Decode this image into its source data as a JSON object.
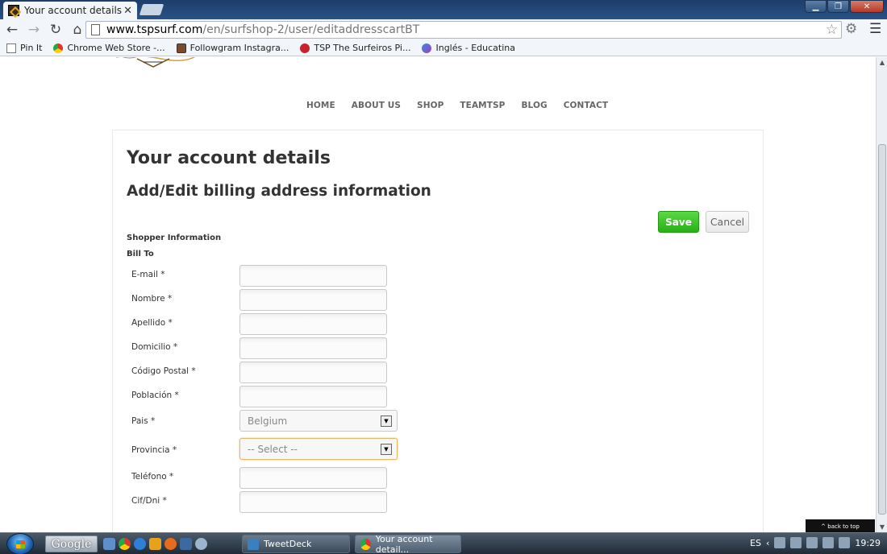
{
  "browser": {
    "tab_title": "Your account details",
    "tab_close": "✕",
    "url_host": "www.tspsurf.com",
    "url_path": "/en/surfshop-2/user/editaddresscartBT",
    "bookmarks": [
      "Pin It",
      "Chrome Web Store -...",
      "Followgram Instagra...",
      "TSP The Surfeiros Pi...",
      "Inglés - Educatina"
    ]
  },
  "nav": {
    "items": [
      "HOME",
      "ABOUT US",
      "SHOP",
      "TEAMTSP",
      "BLOG",
      "CONTACT"
    ]
  },
  "page": {
    "title": "Your account details",
    "subtitle": "Add/Edit billing address information",
    "save_label": "Save",
    "cancel_label": "Cancel",
    "section_shopper": "Shopper Information",
    "section_bill_to": "Bill To",
    "back_to_top": "^ back to top"
  },
  "form": {
    "email_label": "E-mail *",
    "nombre_label": "Nombre *",
    "apellido_label": "Apellido *",
    "domicilio_label": "Domicilio *",
    "codigo_label": "Código Postal *",
    "poblacion_label": "Población *",
    "pais_label": "Pais *",
    "pais_value": "Belgium",
    "provincia_label": "Provincia *",
    "provincia_value": "-- Select --",
    "telefono_label": "Teléfono *",
    "cif_label": "Cif/Dni *"
  },
  "taskbar": {
    "google": "Google",
    "tasks": [
      "TweetDeck",
      "Your account detail..."
    ],
    "lang": "ES",
    "clock": "19:29"
  },
  "icons": {
    "start": "windows-orb-icon",
    "star": "star-icon",
    "wrench": "wrench-icon"
  },
  "colors": {
    "save_green": "#28b018",
    "heading": "#333333",
    "nav_text": "#666666"
  }
}
